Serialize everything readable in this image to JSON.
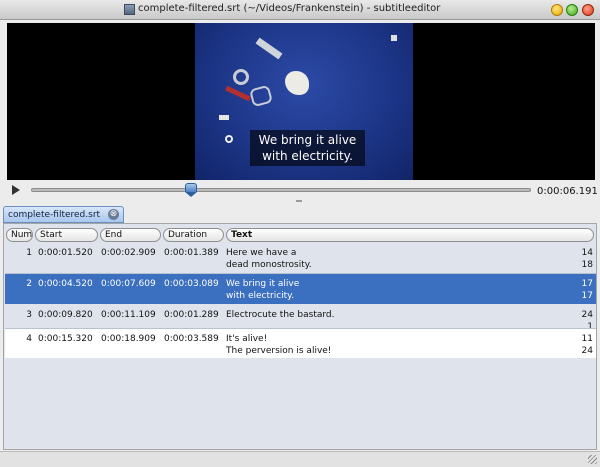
{
  "window": {
    "title": "complete-filtered.srt (~/Videos/Frankenstein) - subtitleeditor",
    "app_icon": "film-icon"
  },
  "video": {
    "subtitle_line1": "We bring it alive",
    "subtitle_line2": "with electricity."
  },
  "player": {
    "time": "0:00:06.191",
    "position_fraction": 0.32
  },
  "tab": {
    "label": "complete-filtered.srt",
    "close_icon": "⊗"
  },
  "columns": {
    "num": "Num",
    "start": "Start",
    "end": "End",
    "duration": "Duration",
    "text": "Text"
  },
  "rows": [
    {
      "num": "1",
      "start": "0:00:01.520",
      "end": "0:00:02.909",
      "duration": "0:00:01.389",
      "text1": "Here we have a",
      "text2": "dead monostrosity.",
      "cps1": "14",
      "cps2": "18"
    },
    {
      "num": "2",
      "start": "0:00:04.520",
      "end": "0:00:07.609",
      "duration": "0:00:03.089",
      "text1": "We bring it alive",
      "text2": "with electricity.",
      "cps1": "17",
      "cps2": "17"
    },
    {
      "num": "3",
      "start": "0:00:09.820",
      "end": "0:00:11.109",
      "duration": "0:00:01.289",
      "text1": "Electrocute the bastard.",
      "text2": "",
      "cps1": "24",
      "cps2": "1"
    },
    {
      "num": "4",
      "start": "0:00:15.320",
      "end": "0:00:18.909",
      "duration": "0:00:03.589",
      "text1": "It's alive!",
      "text2": "The perversion is alive!",
      "cps1": "11",
      "cps2": "24"
    }
  ],
  "colors": {
    "selection": "#3b6fc0",
    "tab_active": "#a9c7ee"
  }
}
